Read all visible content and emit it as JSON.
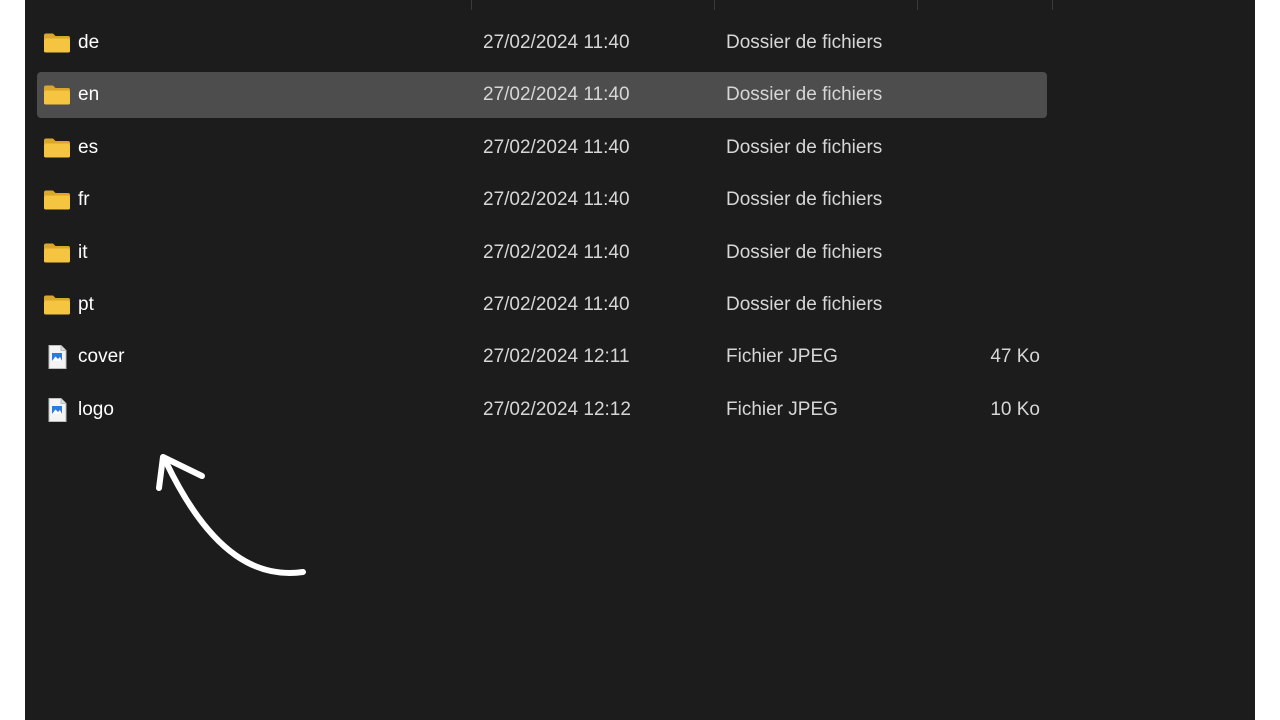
{
  "files": [
    {
      "name": "de",
      "modified": "27/02/2024 11:40",
      "type": "Dossier de fichiers",
      "size": "",
      "icon": "folder-icon",
      "selected": false
    },
    {
      "name": "en",
      "modified": "27/02/2024 11:40",
      "type": "Dossier de fichiers",
      "size": "",
      "icon": "folder-icon",
      "selected": true
    },
    {
      "name": "es",
      "modified": "27/02/2024 11:40",
      "type": "Dossier de fichiers",
      "size": "",
      "icon": "folder-icon",
      "selected": false
    },
    {
      "name": "fr",
      "modified": "27/02/2024 11:40",
      "type": "Dossier de fichiers",
      "size": "",
      "icon": "folder-icon",
      "selected": false
    },
    {
      "name": "it",
      "modified": "27/02/2024 11:40",
      "type": "Dossier de fichiers",
      "size": "",
      "icon": "folder-icon",
      "selected": false
    },
    {
      "name": "pt",
      "modified": "27/02/2024 11:40",
      "type": "Dossier de fichiers",
      "size": "",
      "icon": "folder-icon",
      "selected": false
    },
    {
      "name": "cover",
      "modified": "27/02/2024 12:11",
      "type": "Fichier JPEG",
      "size": "47 Ko",
      "icon": "image-file-icon",
      "selected": false
    },
    {
      "name": "logo",
      "modified": "27/02/2024 12:12",
      "type": "Fichier JPEG",
      "size": "10 Ko",
      "icon": "image-file-icon",
      "selected": false
    }
  ],
  "colors": {
    "background": "#1c1c1c",
    "selected_row": "#4d4d4d",
    "folder": "#f5c542",
    "text": "#ffffff",
    "annotation_arrow": "#ffffff"
  }
}
